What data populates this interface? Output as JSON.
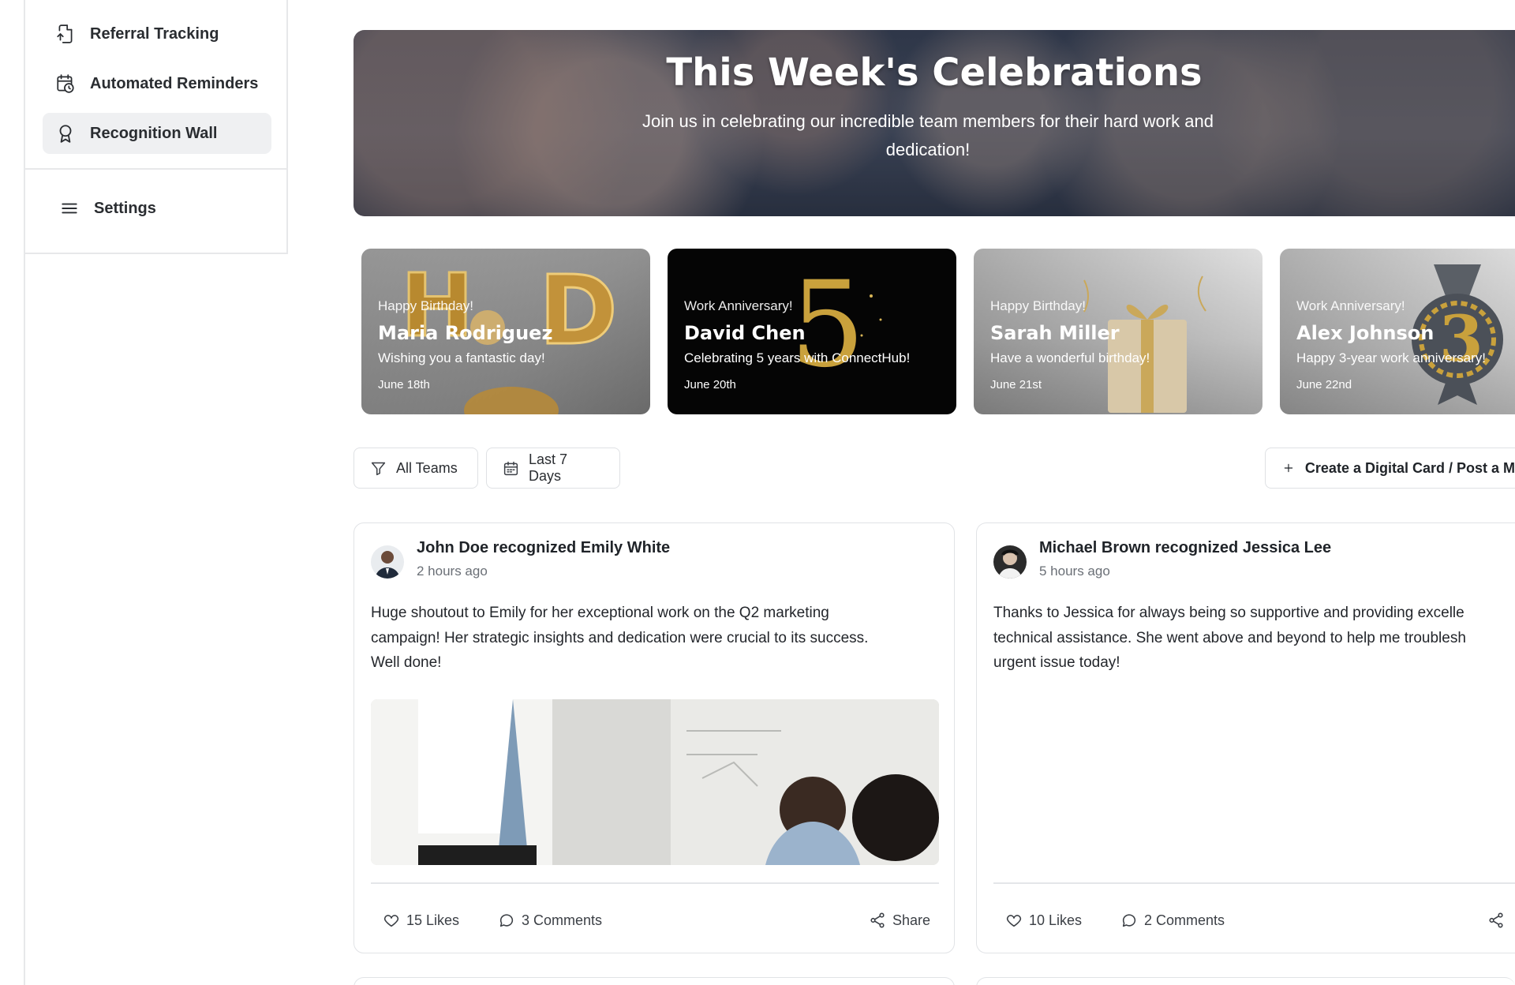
{
  "sidebar": {
    "items": [
      {
        "label": "Referral Tracking",
        "icon": "referral-file-icon"
      },
      {
        "label": "Automated Reminders",
        "icon": "calendar-clock-icon"
      },
      {
        "label": "Recognition Wall",
        "icon": "award-ribbon-icon",
        "active": true
      }
    ],
    "settings": {
      "label": "Settings",
      "icon": "menu-lines-icon"
    }
  },
  "hero": {
    "title": "This Week's Celebrations",
    "subtitle_line1": "Join us in celebrating our incredible team members for their hard work and",
    "subtitle_line2": "dedication!"
  },
  "celebrations": [
    {
      "kicker": "Happy Birthday!",
      "name": "Maria Rodriguez",
      "message": "Wishing you a fantastic day!",
      "date": "June 18th"
    },
    {
      "kicker": "Work Anniversary!",
      "name": "David Chen",
      "message": "Celebrating 5 years with ConnectHub!",
      "date": "June 20th"
    },
    {
      "kicker": "Happy Birthday!",
      "name": "Sarah Miller",
      "message": "Have a wonderful birthday!",
      "date": "June 21st"
    },
    {
      "kicker": "Work Anniversary!",
      "name": "Alex Johnson",
      "message": "Happy 3-year work anniversary!",
      "date": "June 22nd"
    }
  ],
  "filters": {
    "teams_label": "All Teams",
    "range_label": "Last 7 Days",
    "create_label": "Create a Digital Card / Post a M"
  },
  "posts": [
    {
      "title": "John Doe recognized Emily White",
      "time": "2 hours ago",
      "body_lines": [
        "Huge shoutout to Emily for her exceptional work on the Q2 marketing",
        "campaign! Her strategic insights and dedication were crucial to its success.",
        "Well done!"
      ],
      "likes": "15 Likes",
      "comments": "3 Comments",
      "share": "Share"
    },
    {
      "title": "Michael Brown recognized Jessica Lee",
      "time": "5 hours ago",
      "body_lines": [
        "Thanks to Jessica for always being so supportive and providing excelle",
        "technical assistance. She went above and beyond to help me troublesh",
        "urgent issue today!"
      ],
      "likes": "10 Likes",
      "comments": "2 Comments"
    }
  ],
  "colors": {
    "active_nav_bg": "#eff0f2",
    "border": "#e1e3e6",
    "gold": "#c9a13c",
    "text_muted": "#6a6f76"
  }
}
